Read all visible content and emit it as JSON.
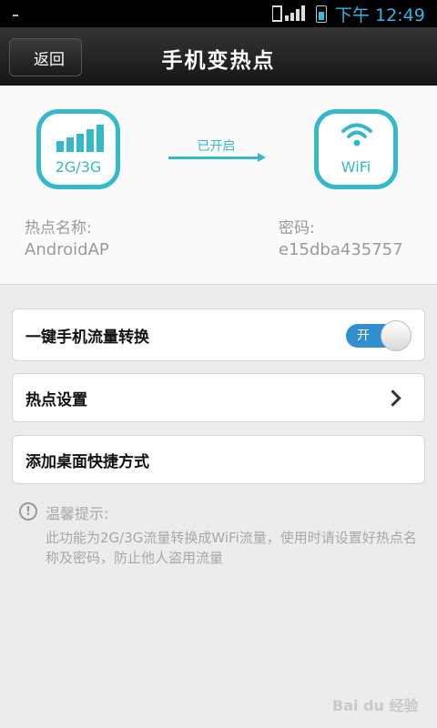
{
  "status_bar": {
    "time": "下午 12:49",
    "icons": [
      "signal-icon",
      "battery-icon"
    ]
  },
  "title_bar": {
    "back_label": "返回",
    "title": "手机变热点"
  },
  "hero": {
    "left_badge_label": "2G/3G",
    "right_badge_label": "WiFi",
    "arrow_text": "已开启",
    "hotspot_name_label": "热点名称:",
    "hotspot_name_value": "AndroidAP",
    "password_label": "密码:",
    "password_value": "e15dba435757",
    "accent_color": "#34b9cb"
  },
  "settings": {
    "toggle_row_label": "一键手机流量转换",
    "toggle_state": "开",
    "hotspot_settings_label": "热点设置",
    "shortcut_label": "添加桌面快捷方式"
  },
  "tips": {
    "title": "温馨提示:",
    "body": "此功能为2G/3G流量转换成WiFi流量，使用时请设置好热点名称及密码，防止他人盗用流量"
  },
  "watermark": "Bai du 经验"
}
